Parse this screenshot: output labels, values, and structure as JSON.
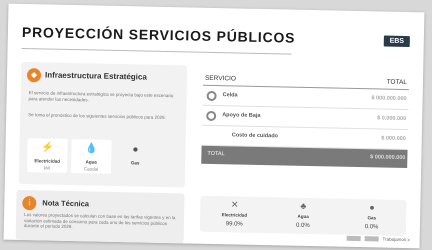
{
  "header": {
    "title": "PROYECCIÓN SERVICIOS PÚBLICOS",
    "logo_text": "EBS"
  },
  "infra": {
    "icon": "shield-icon",
    "title": "Infraestructura Estratégica",
    "text1": "El servicio de infraestructura estratégica se proyecta bajo este escenario para atender las necesidades.",
    "text2": "Se toma el pronóstico de los siguientes servicios públicos para 2026:",
    "cards": [
      {
        "icon": "lightning-icon",
        "label": "Electricidad",
        "value": "kW"
      },
      {
        "icon": "water-drop-icon",
        "label": "Agua",
        "value": "Caudal"
      },
      {
        "icon": "flame-icon",
        "label": "Gas",
        "value": ""
      }
    ]
  },
  "table": {
    "col_service": "SERVICIO",
    "col_total": "TOTAL",
    "rows": [
      {
        "name": "Celda",
        "amount": "$ 000.000.000"
      },
      {
        "name": "Apoyo de Baja",
        "amount": "$ 0.000.000"
      },
      {
        "name": "Costo de cuidado",
        "amount": "$ 000.000"
      }
    ],
    "total_label": "TOTAL",
    "total_amount": "$ 000.000.000"
  },
  "note": {
    "icon": "info-icon",
    "title": "Nota Técnica",
    "text": "Los valores proyectados se calculan con base en las tarifas vigentes y en la variación estimada de consumo para cada uno de los servicios públicos durante el periodo 2026."
  },
  "stats": [
    {
      "icon": "lightning-icon",
      "label": "Electricidad",
      "value": "99.0%"
    },
    {
      "icon": "water-drop-icon",
      "label": "Agua",
      "value": "0.0%"
    },
    {
      "icon": "flame-icon",
      "label": "Gas",
      "value": "0.0%"
    }
  ],
  "footer": {
    "label": "Trabajamos x"
  }
}
